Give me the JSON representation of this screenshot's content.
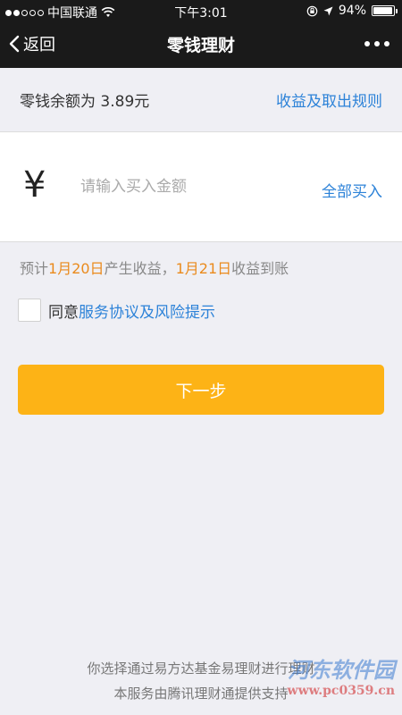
{
  "status_bar": {
    "carrier": "中国联通",
    "time": "下午3:01",
    "battery": "94%",
    "battery_level": 0.94
  },
  "nav": {
    "back_label": "返回",
    "title": "零钱理财"
  },
  "balance": {
    "label": "零钱余额为 3.89元",
    "rules_link": "收益及取出规则"
  },
  "purchase": {
    "currency_symbol": "¥",
    "amount_placeholder": "请输入买入金额",
    "buy_all_label": "全部买入"
  },
  "estimate": {
    "prefix": "预计",
    "earn_date": "1月20日",
    "middle": "产生收益，",
    "arrive_date": "1月21日",
    "suffix": "收益到账"
  },
  "agreement": {
    "prefix": "同意",
    "link": "服务协议及风险提示"
  },
  "next_button": "下一步",
  "footer": {
    "line1": "你选择通过易方达基金易理财进行理财",
    "line2": "本服务由腾讯理财通提供支持"
  },
  "watermark": {
    "name": "河东软件园",
    "url": "www.pc0359.cn"
  },
  "colors": {
    "nav_bg": "#1a1a1a",
    "link": "#2c82d8",
    "highlight": "#ea8a1c",
    "button": "#fdb316",
    "page_bg": "#efeff4"
  }
}
